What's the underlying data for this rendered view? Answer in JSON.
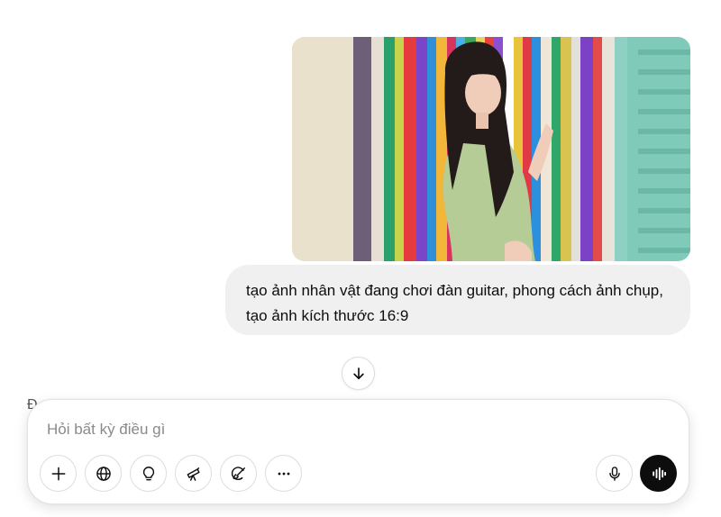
{
  "attachment": {
    "alt_icon": "photo-thumbnail"
  },
  "message": {
    "text": "tạo ảnh nhân vật đang chơi đàn guitar, phong cách ảnh chụp, tạo ảnh kích thước 16:9"
  },
  "partial_text": "Đ",
  "composer": {
    "placeholder": "Hỏi bất kỳ điều gì",
    "value": ""
  },
  "tools": [
    {
      "icon": "plus-icon"
    },
    {
      "icon": "globe-icon"
    },
    {
      "icon": "lightbulb-icon"
    },
    {
      "icon": "telescope-icon"
    },
    {
      "icon": "paint-brush-icon"
    },
    {
      "icon": "more-icon"
    }
  ],
  "icons": {
    "scroll": "arrow-down-icon",
    "mic": "microphone-icon",
    "voice": "voice-waveform-icon"
  },
  "colors": {
    "bubble": "#f0f0f0",
    "voice_button": "#0d0d0d",
    "placeholder": "#8a8a8a"
  }
}
